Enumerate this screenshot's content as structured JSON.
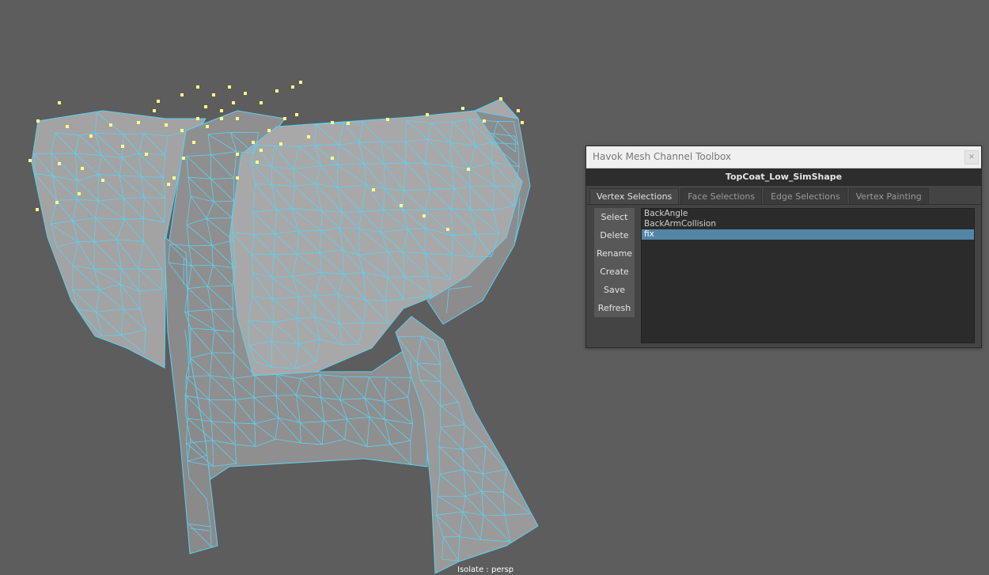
{
  "viewport": {
    "label": "Isolate : persp",
    "colors": {
      "background": "#5d5d5d",
      "mesh_fill": "#9b9b9b",
      "wire": "#5ad2f4",
      "vertex": "#ffff88"
    }
  },
  "toolbox": {
    "title": "Havok Mesh Channel Toolbox",
    "close_icon": "close-icon",
    "shape_name": "TopCoat_Low_SimShape",
    "tabs": [
      {
        "label": "Vertex Selections",
        "active": true
      },
      {
        "label": "Face Selections",
        "active": false
      },
      {
        "label": "Edge Selections",
        "active": false
      },
      {
        "label": "Vertex Painting",
        "active": false
      }
    ],
    "buttons": [
      "Select",
      "Delete",
      "Rename",
      "Create",
      "Save",
      "Refresh"
    ],
    "selections": [
      {
        "label": "BackAngle",
        "selected": false
      },
      {
        "label": "BackArmCollision",
        "selected": false
      },
      {
        "label": "fix",
        "selected": true
      }
    ],
    "accent_color": "#5285a6"
  }
}
